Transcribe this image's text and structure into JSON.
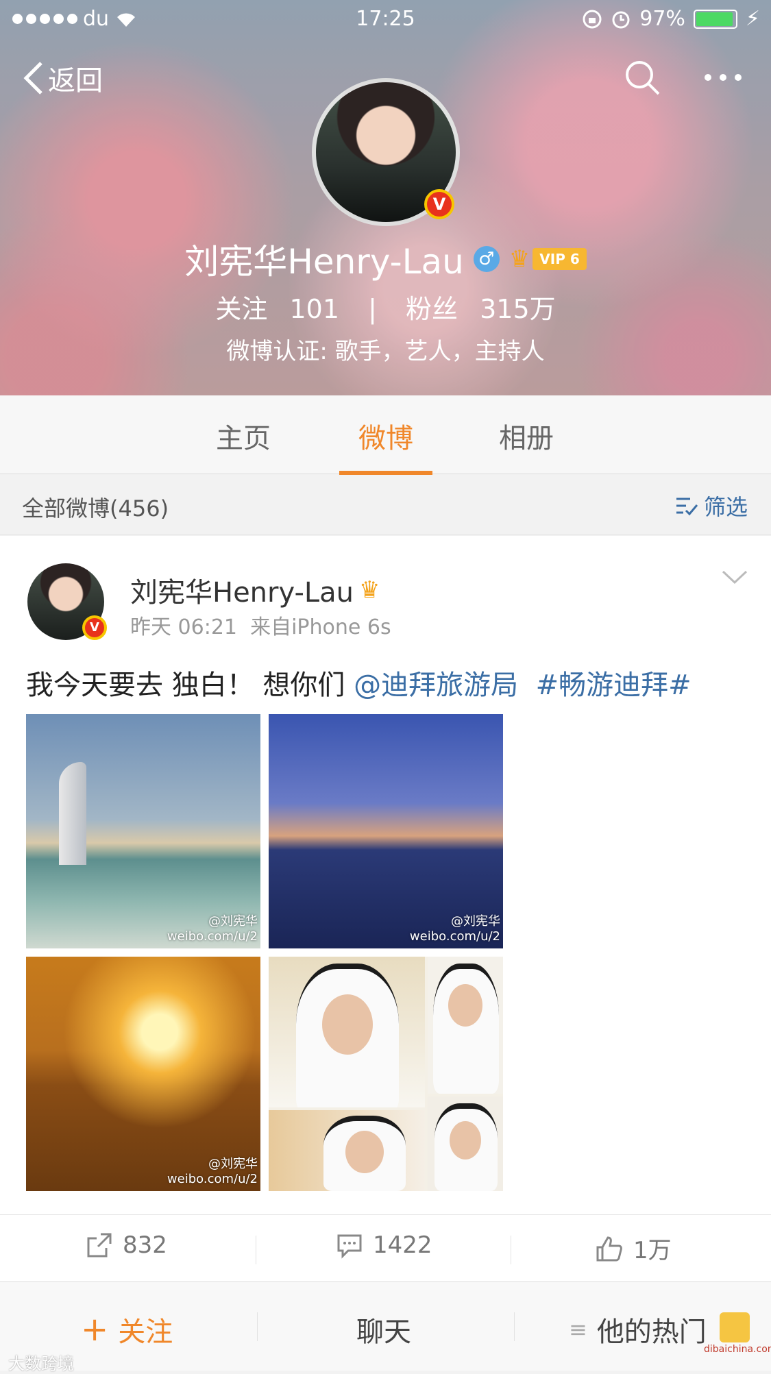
{
  "status_bar": {
    "carrier": "du",
    "time": "17:25",
    "battery": "97%"
  },
  "nav": {
    "back_label": "返回"
  },
  "profile": {
    "name": "刘宪华Henry-Lau",
    "gender": "♂",
    "vip": "VIP 6",
    "following_label": "关注",
    "following_count": "101",
    "divider": "|",
    "followers_label": "粉丝",
    "followers_count": "315万",
    "verification": "微博认证: 歌手，艺人，主持人"
  },
  "tabs": [
    {
      "label": "主页"
    },
    {
      "label": "微博",
      "active": true
    },
    {
      "label": "相册"
    }
  ],
  "filter": {
    "count_label": "全部微博(456)",
    "filter_label": "筛选"
  },
  "post": {
    "author": "刘宪华Henry-Lau",
    "time": "昨天 06:21",
    "source": "来自iPhone 6s",
    "text": "我今天要去 独白！  想你们 ",
    "mention": "@迪拜旅游局",
    "hashtag": "#畅游迪拜#",
    "watermark_a": "@刘宪华",
    "watermark_b": "weibo.com/u/2",
    "reposts": "832",
    "comments": "1422",
    "likes": "1万"
  },
  "bottom_bar": {
    "follow": "关注",
    "chat": "聊天",
    "hot": "他的热门"
  },
  "watermarks": {
    "left": "大数跨境",
    "right": "dibaichina.com"
  },
  "colors": {
    "accent": "#f0872a",
    "link": "#3b6ea5",
    "verify_badge": "#e8321c"
  }
}
